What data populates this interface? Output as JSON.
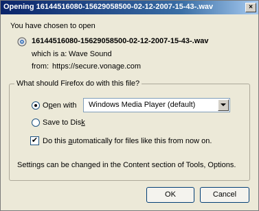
{
  "window": {
    "title": "Opening 16144516080-15629058500-02-12-2007-15-43-.wav",
    "close_glyph": "×"
  },
  "intro": "You have chosen to open",
  "file": {
    "name": "16144516080-15629058500-02-12-2007-15-43-.wav",
    "icon": "wave-sound-file-icon",
    "type_label": "which is a:",
    "type_value": "Wave Sound",
    "from_label": "from:",
    "from_value": "https://secure.vonage.com"
  },
  "question": "What should Firefox do with this file?",
  "options": {
    "open_with_pre": "O",
    "open_with_acc": "p",
    "open_with_post": "en with",
    "open_with_selected": true,
    "app_select_value": "Windows Media Player (default)",
    "save_pre": "Save to Dis",
    "save_acc": "k",
    "save_selected": false,
    "auto_pre": "Do this ",
    "auto_acc": "a",
    "auto_post": "utomatically for files like this from now on.",
    "auto_checked": true,
    "check_glyph": "✔"
  },
  "settings_note": "Settings can be changed in the Content section of Tools, Options.",
  "buttons": {
    "ok": "OK",
    "cancel": "Cancel"
  }
}
